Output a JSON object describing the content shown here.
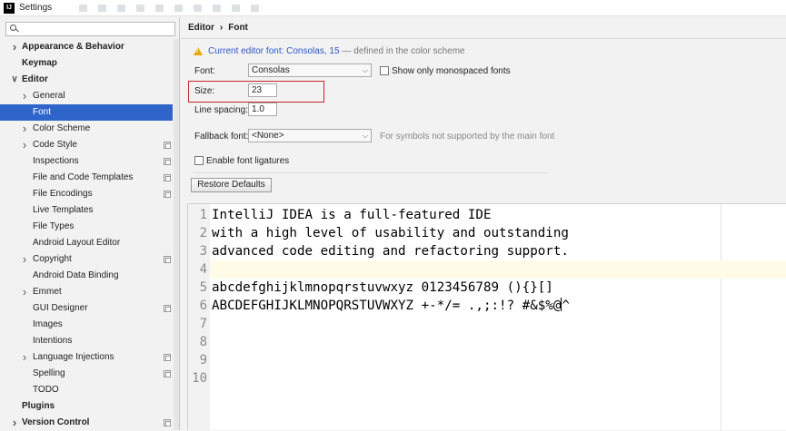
{
  "window": {
    "title": "Settings",
    "icon_label": "IJ"
  },
  "sidebar": {
    "search": {
      "value": "",
      "placeholder": ""
    },
    "items": [
      {
        "label": "Appearance & Behavior",
        "level": 0,
        "bold": true,
        "arrow": "right",
        "copy": false
      },
      {
        "label": "Keymap",
        "level": 0,
        "bold": true,
        "arrow": "",
        "copy": false
      },
      {
        "label": "Editor",
        "level": 0,
        "bold": true,
        "arrow": "down",
        "copy": false
      },
      {
        "label": "General",
        "level": 1,
        "bold": false,
        "arrow": "right",
        "copy": false
      },
      {
        "label": "Font",
        "level": 1,
        "bold": false,
        "arrow": "",
        "copy": false,
        "selected": true
      },
      {
        "label": "Color Scheme",
        "level": 1,
        "bold": false,
        "arrow": "right",
        "copy": false
      },
      {
        "label": "Code Style",
        "level": 1,
        "bold": false,
        "arrow": "right",
        "copy": true
      },
      {
        "label": "Inspections",
        "level": 1,
        "bold": false,
        "arrow": "",
        "copy": true
      },
      {
        "label": "File and Code Templates",
        "level": 1,
        "bold": false,
        "arrow": "",
        "copy": true
      },
      {
        "label": "File Encodings",
        "level": 1,
        "bold": false,
        "arrow": "",
        "copy": true
      },
      {
        "label": "Live Templates",
        "level": 1,
        "bold": false,
        "arrow": "",
        "copy": false
      },
      {
        "label": "File Types",
        "level": 1,
        "bold": false,
        "arrow": "",
        "copy": false
      },
      {
        "label": "Android Layout Editor",
        "level": 1,
        "bold": false,
        "arrow": "",
        "copy": false
      },
      {
        "label": "Copyright",
        "level": 1,
        "bold": false,
        "arrow": "right",
        "copy": true
      },
      {
        "label": "Android Data Binding",
        "level": 1,
        "bold": false,
        "arrow": "",
        "copy": false
      },
      {
        "label": "Emmet",
        "level": 1,
        "bold": false,
        "arrow": "right",
        "copy": false
      },
      {
        "label": "GUI Designer",
        "level": 1,
        "bold": false,
        "arrow": "",
        "copy": true
      },
      {
        "label": "Images",
        "level": 1,
        "bold": false,
        "arrow": "",
        "copy": false
      },
      {
        "label": "Intentions",
        "level": 1,
        "bold": false,
        "arrow": "",
        "copy": false
      },
      {
        "label": "Language Injections",
        "level": 1,
        "bold": false,
        "arrow": "right",
        "copy": true
      },
      {
        "label": "Spelling",
        "level": 1,
        "bold": false,
        "arrow": "",
        "copy": true
      },
      {
        "label": "TODO",
        "level": 1,
        "bold": false,
        "arrow": "",
        "copy": false
      },
      {
        "label": "Plugins",
        "level": 0,
        "bold": true,
        "arrow": "",
        "copy": false
      },
      {
        "label": "Version Control",
        "level": 0,
        "bold": true,
        "arrow": "right",
        "copy": true
      }
    ]
  },
  "main": {
    "breadcrumb": {
      "parent": "Editor",
      "separator": "›",
      "current": "Font"
    },
    "notice": {
      "link": "Current editor font: Consolas, 15",
      "rest": "— defined in the color scheme"
    },
    "font": {
      "label": "Font:",
      "value": "Consolas"
    },
    "monospaced": {
      "label": "Show only monospaced fonts"
    },
    "size": {
      "label": "Size:",
      "value": "23"
    },
    "line_spacing": {
      "label": "Line spacing:",
      "value": "1.0"
    },
    "fallback": {
      "label": "Fallback font:",
      "value": "<None>",
      "hint": "For symbols not supported by the main font"
    },
    "ligatures": {
      "label": "Enable font ligatures"
    },
    "restore_button": "Restore Defaults"
  },
  "preview": {
    "line_numbers": [
      "1",
      "2",
      "3",
      "4",
      "5",
      "6",
      "7",
      "8",
      "9",
      "10"
    ],
    "lines": [
      "IntelliJ IDEA is a full-featured IDE",
      "with a high level of usability and outstanding",
      "advanced code editing and refactoring support.",
      "",
      "abcdefghijklmnopqrstuvwxyz 0123456789 (){}[]",
      "ABCDEFGHIJKLMNOPQRSTUVWXYZ +-*/= .,;:!? #&$%@",
      "",
      "",
      "",
      ""
    ],
    "line6_after_caret": "^"
  }
}
